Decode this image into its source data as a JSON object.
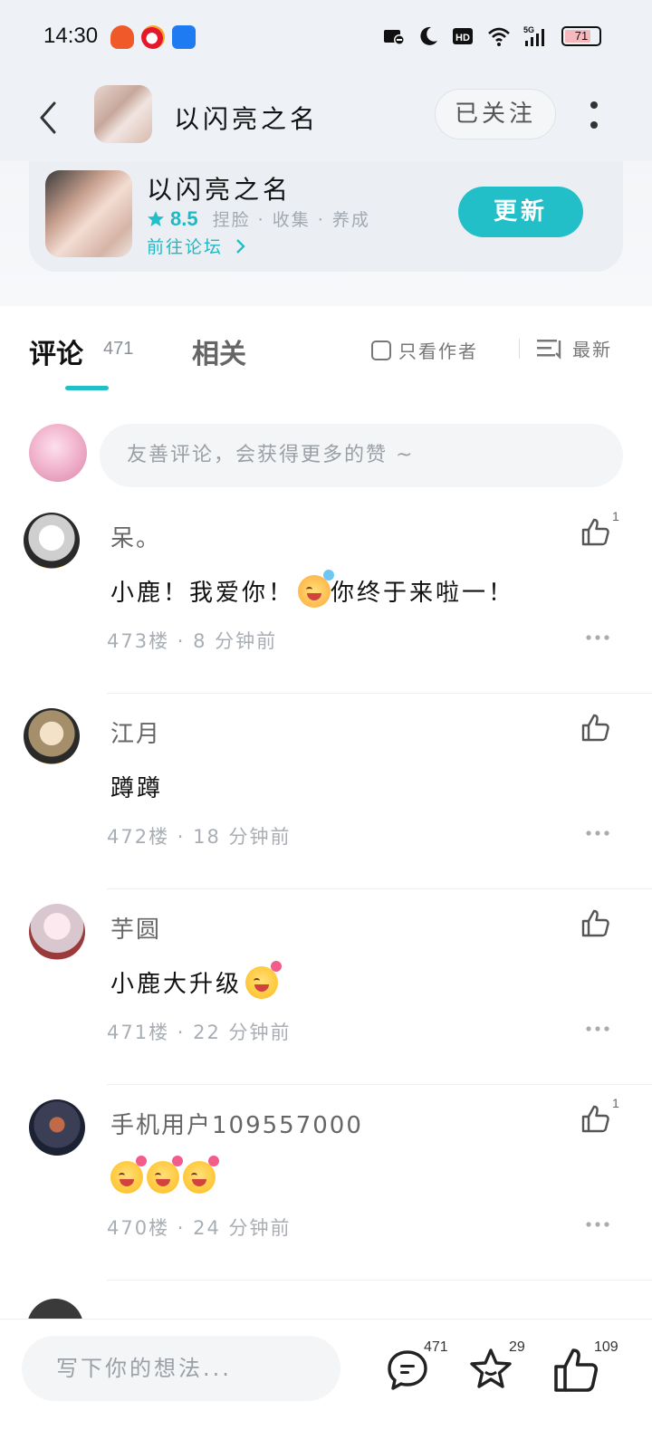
{
  "status_bar": {
    "time": "14:30",
    "battery": "71",
    "icons": [
      "app-icon-red",
      "weibo-icon",
      "app-icon-blue",
      "notification-off-icon",
      "moon-icon",
      "hd-icon",
      "wifi-icon",
      "5g-signal-icon",
      "battery-icon"
    ]
  },
  "header": {
    "title": "以闪亮之名",
    "follow_label": "已关注"
  },
  "game_card": {
    "title": "以闪亮之名",
    "rating": "8.5",
    "tags": "捏脸 · 收集 · 养成",
    "forum_link": "前往论坛",
    "update_label": "更新"
  },
  "tabs": {
    "comments_label": "评论",
    "comments_count": "471",
    "related_label": "相关",
    "author_only_label": "只看作者",
    "sort_label": "最新"
  },
  "comment_input": {
    "placeholder": "友善评论，会获得更多的赞 ~"
  },
  "comments": [
    {
      "name": "呆。",
      "text": "小鹿！我爱你！",
      "text_after": "你终于来啦一！",
      "meta": "473楼 · 8 分钟前",
      "likes": "1"
    },
    {
      "name": "江月",
      "text": "蹲蹲",
      "text_after": "",
      "meta": "472楼 · 18 分钟前",
      "likes": ""
    },
    {
      "name": "芋圆",
      "text": "小鹿大升级",
      "text_after": "",
      "meta": "471楼 · 22 分钟前",
      "likes": ""
    },
    {
      "name": "手机用户109557000",
      "text": "",
      "text_after": "",
      "meta": "470楼 · 24 分钟前",
      "likes": "1"
    }
  ],
  "bottom_bar": {
    "placeholder": "写下你的想法...",
    "comments_count": "471",
    "favorites_count": "29",
    "likes_count": "109"
  },
  "colors": {
    "accent": "#22bfc8",
    "header_bg": "#eef2f6"
  }
}
